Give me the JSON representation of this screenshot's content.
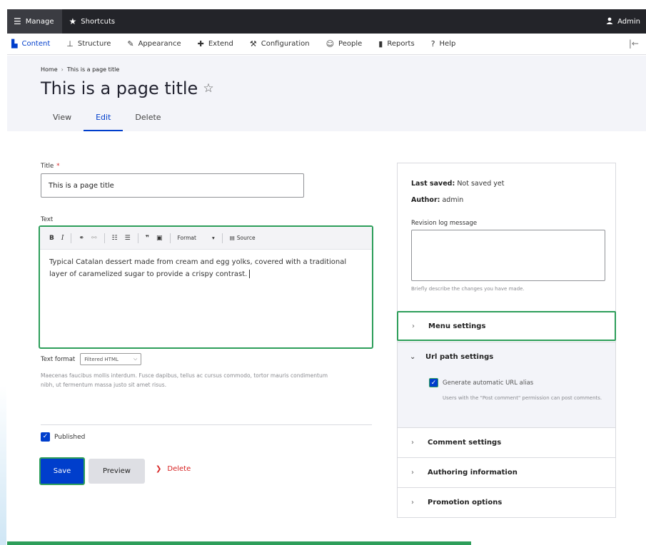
{
  "toolbar": {
    "manage": "Manage",
    "shortcuts": "Shortcuts",
    "admin": "Admin"
  },
  "tray": {
    "items": [
      {
        "label": "Content",
        "icon": "content-icon"
      },
      {
        "label": "Structure",
        "icon": "structure-icon"
      },
      {
        "label": "Appearance",
        "icon": "appearance-icon"
      },
      {
        "label": "Extend",
        "icon": "extend-icon"
      },
      {
        "label": "Configuration",
        "icon": "wrench-icon"
      },
      {
        "label": "People",
        "icon": "people-icon"
      },
      {
        "label": "Reports",
        "icon": "reports-icon"
      },
      {
        "label": "Help",
        "icon": "help-icon"
      }
    ]
  },
  "header": {
    "breadcrumb": [
      "Home",
      "This is a page title"
    ],
    "breadcrumb_sep": "›",
    "title": "This is a page title",
    "tabs": [
      "View",
      "Edit",
      "Delete"
    ],
    "active_tab": "Edit"
  },
  "form": {
    "title_label": "Title",
    "required_mark": "*",
    "title_value": "This is a page title",
    "text_label": "Text",
    "editor_toolbar": {
      "bold": "B",
      "italic": "I",
      "format": "Format",
      "source": "Source"
    },
    "body": "Typical Catalan dessert made from cream and egg yolks, covered with a traditional layer of caramelized sugar to provide a crispy contrast.",
    "text_format_label": "Text format",
    "text_format_value": "Filtered HTML",
    "text_format_desc": "Maecenas faucibus mollis interdum. Fusce dapibus, tellus ac cursus commodo, tortor mauris condimentum nibh, ut fermentum massa justo sit amet risus.",
    "published_label": "Published",
    "published": true,
    "save": "Save",
    "preview": "Preview",
    "delete": "Delete"
  },
  "sidebar": {
    "last_saved_label": "Last saved:",
    "last_saved_value": "Not saved yet",
    "author_label": "Author:",
    "author_value": "admin",
    "revision_label": "Revision log message",
    "revision_desc": "Briefly describe the changes you have made.",
    "menu_settings": "Menu settings",
    "url_path_settings": "Url path settings",
    "generate_alias": "Generate automatic URL alias",
    "generate_alias_checked": true,
    "url_desc": "Users with the \"Post comment\" permission can post comments.",
    "comment_settings": "Comment settings",
    "authoring_information": "Authoring information",
    "promotion_options": "Promotion options"
  },
  "colors": {
    "accent": "#003ecc",
    "focus": "#2d9e5a",
    "danger": "#d72222",
    "toolbar_bg": "#232429"
  }
}
